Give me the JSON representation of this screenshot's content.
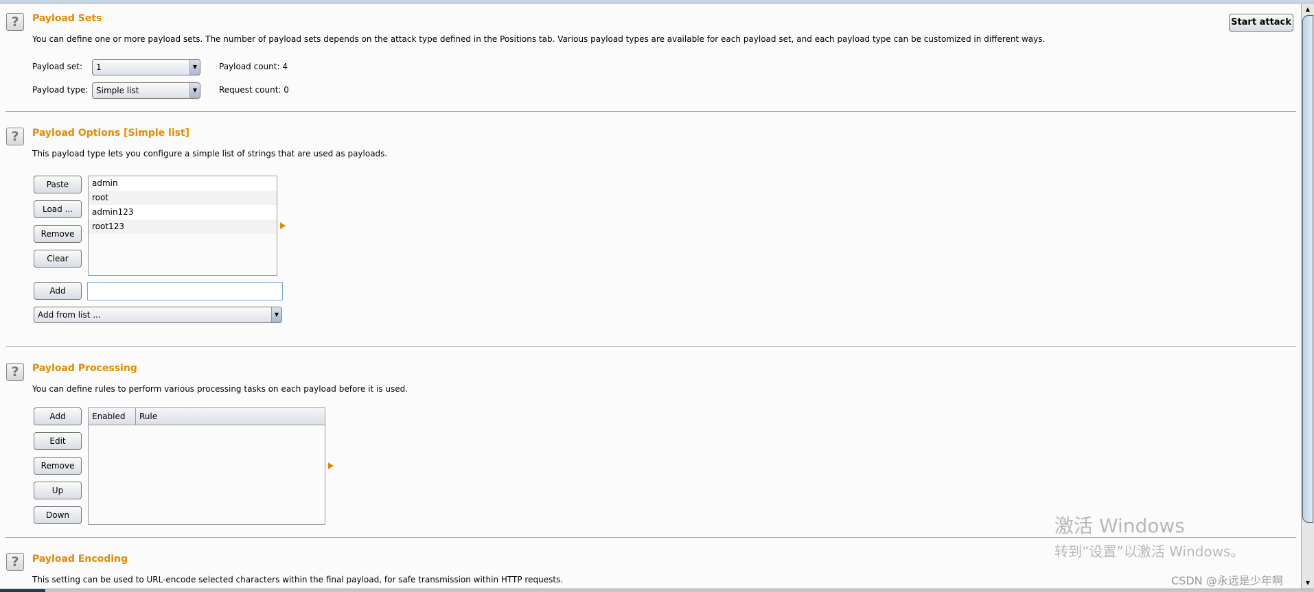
{
  "payload_sets": {
    "title": "Payload Sets",
    "description": "You can define one or more payload sets. The number of payload sets depends on the attack type defined in the Positions tab. Various payload types are available for each payload set, and each payload type can be customized in different ways.",
    "set_label": "Payload set:",
    "set_value": "1",
    "type_label": "Payload type:",
    "type_value": "Simple list",
    "payload_count": "Payload count:  4",
    "request_count": "Request count:  0",
    "start_attack": "Start attack"
  },
  "payload_options": {
    "title": "Payload Options [Simple list]",
    "description": "This payload type lets you configure a simple list of strings that are used as payloads.",
    "buttons": [
      "Paste",
      "Load ...",
      "Remove",
      "Clear"
    ],
    "items": [
      "admin",
      "root",
      "admin123",
      "root123"
    ],
    "add_label": "Add",
    "add_value": "",
    "add_from_list": "Add from list ..."
  },
  "payload_processing": {
    "title": "Payload Processing",
    "description": "You can define rules to perform various processing tasks on each payload before it is used.",
    "buttons": [
      "Add",
      "Edit",
      "Remove",
      "Up",
      "Down"
    ],
    "columns": [
      "Enabled",
      "Rule"
    ]
  },
  "payload_encoding": {
    "title": "Payload Encoding",
    "description": "This setting can be used to URL-encode selected characters within the final payload, for safe transmission within HTTP requests."
  },
  "watermark": {
    "line1": "激活 Windows",
    "line2": "转到“设置”以激活 Windows。",
    "credit": "CSDN @永远是少年啊"
  },
  "colors": {
    "accent": "#e58a00"
  }
}
